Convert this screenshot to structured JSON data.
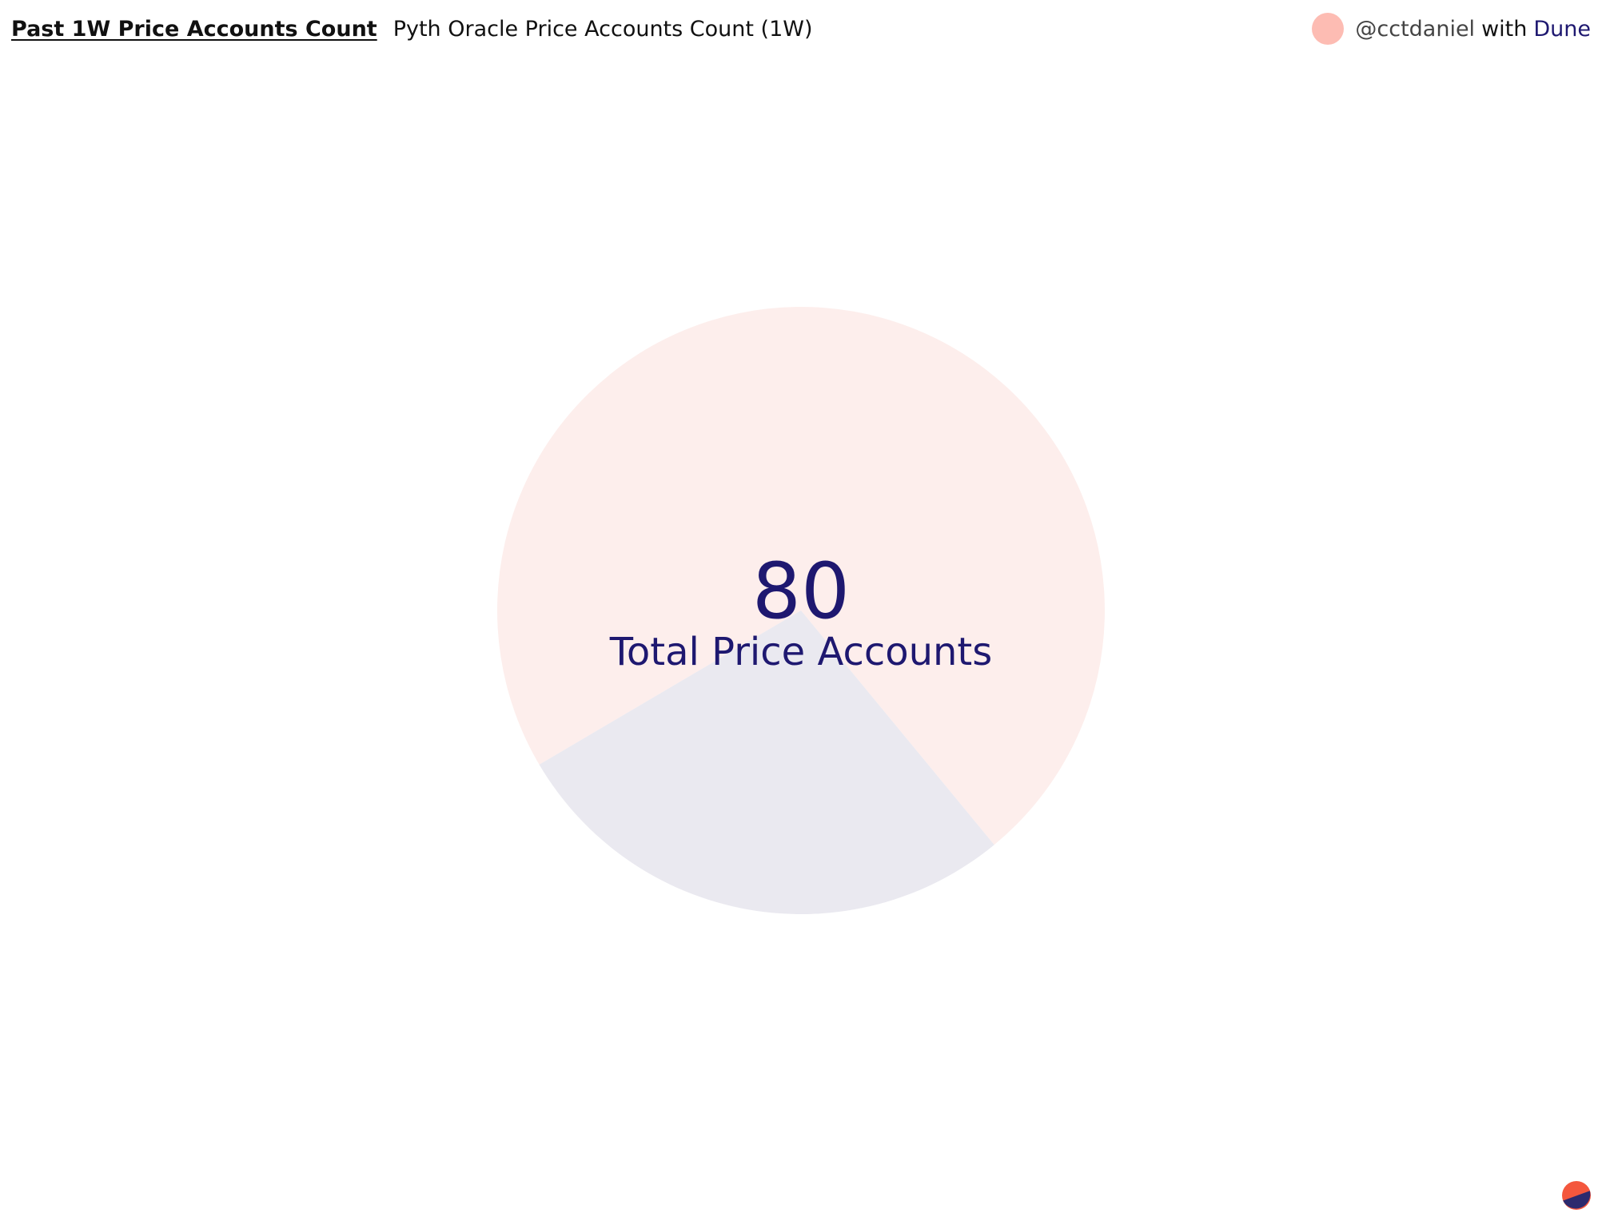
{
  "header": {
    "query_title": "Past 1W Price Accounts Count",
    "viz_title": "Pyth Oracle Price Accounts Count (1W)"
  },
  "attribution": {
    "username": "@cctdaniel",
    "with": "with",
    "brand": "Dune"
  },
  "counter": {
    "value": "80",
    "label": "Total Price Accounts"
  },
  "colors": {
    "navy": "#1e1870",
    "salmon": "#f4573d",
    "slice_light_pink": "#fdeeec",
    "slice_light_gray": "#eae9f0",
    "avatar": "#fdbcb3"
  },
  "chart_data": {
    "type": "pie",
    "title": "",
    "legend": "none",
    "labels": [
      "",
      ""
    ],
    "values": [
      72.5,
      27.5
    ],
    "colors": [
      "#fdeeec",
      "#eae9f0"
    ]
  },
  "icons": {
    "avatar": "user-avatar-icon",
    "logo": "dune-logo-icon"
  }
}
